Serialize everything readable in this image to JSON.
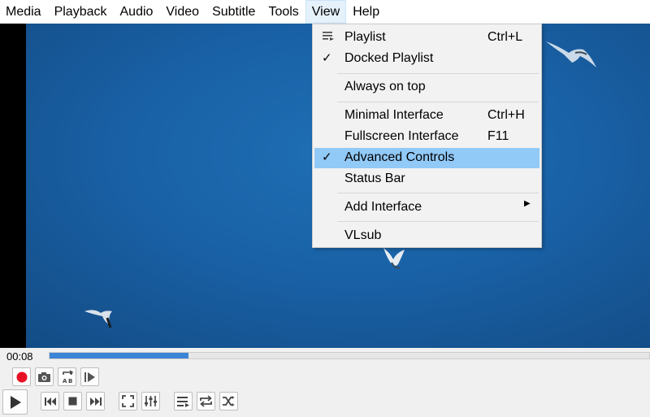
{
  "menubar": {
    "items": [
      {
        "label": "Media"
      },
      {
        "label": "Playback"
      },
      {
        "label": "Audio"
      },
      {
        "label": "Video"
      },
      {
        "label": "Subtitle"
      },
      {
        "label": "Tools"
      },
      {
        "label": "View"
      },
      {
        "label": "Help"
      }
    ],
    "active": "View"
  },
  "view_menu": {
    "items": [
      {
        "label": "Playlist",
        "shortcut": "Ctrl+L",
        "icon": "playlist-icon"
      },
      {
        "label": "Docked Playlist",
        "checked": true
      },
      {
        "label": "Always on top"
      },
      {
        "label": "Minimal Interface",
        "shortcut": "Ctrl+H"
      },
      {
        "label": "Fullscreen Interface",
        "shortcut": "F11"
      },
      {
        "label": "Advanced Controls",
        "checked": true,
        "highlighted": true
      },
      {
        "label": "Status Bar"
      },
      {
        "label": "Add Interface",
        "submenu": true
      },
      {
        "label": "VLsub"
      }
    ]
  },
  "playback": {
    "elapsed": "00:08",
    "progress": 0.232
  },
  "controls": {
    "advanced": [
      "record-icon",
      "snapshot-icon",
      "loop-ab-icon",
      "frame-by-frame-icon"
    ],
    "main": [
      "play-icon",
      "previous-icon",
      "stop-icon",
      "next-icon",
      "fullscreen-icon",
      "extended-settings-icon",
      "playlist-icon",
      "loop-icon",
      "shuffle-icon"
    ]
  },
  "colors": {
    "highlight": "#91c9f7",
    "progress_fill": "#3b84d6",
    "record": "#e81123",
    "video_blue": "#1961a6"
  }
}
